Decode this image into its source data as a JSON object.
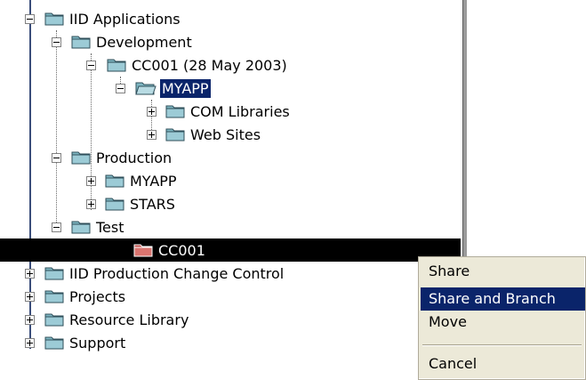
{
  "tree": {
    "nodes": [
      {
        "label": "IID Applications",
        "expander": "expanded",
        "icon": "folder-icon"
      },
      {
        "label": "Development",
        "expander": "expanded",
        "icon": "folder-icon"
      },
      {
        "label": "CC001 (28 May 2003)",
        "expander": "expanded",
        "icon": "folder-icon"
      },
      {
        "label": "MYAPP",
        "expander": "expanded",
        "icon": "open-folder-icon",
        "highlighted": true
      },
      {
        "label": "COM Libraries",
        "expander": "collapsed",
        "icon": "folder-icon"
      },
      {
        "label": "Web Sites",
        "expander": "collapsed",
        "icon": "folder-icon"
      },
      {
        "label": "Production",
        "expander": "expanded",
        "icon": "folder-icon"
      },
      {
        "label": "MYAPP",
        "expander": "collapsed",
        "icon": "folder-icon"
      },
      {
        "label": "STARS",
        "expander": "collapsed",
        "icon": "folder-icon"
      },
      {
        "label": "Test",
        "expander": "expanded",
        "icon": "folder-icon"
      },
      {
        "label": "CC001",
        "expander": "none",
        "icon": "red-folder-icon",
        "selected_row": true
      },
      {
        "label": "IID Production Change Control",
        "expander": "collapsed",
        "icon": "folder-icon"
      },
      {
        "label": "Projects",
        "expander": "collapsed",
        "icon": "folder-icon"
      },
      {
        "label": "Resource Library",
        "expander": "collapsed",
        "icon": "folder-icon"
      },
      {
        "label": "Support",
        "expander": "collapsed",
        "icon": "folder-icon"
      }
    ]
  },
  "context_menu": {
    "share": "Share",
    "share_and_branch": "Share and Branch",
    "move": "Move",
    "cancel": "Cancel",
    "active_item": "Share and Branch"
  },
  "colors": {
    "selection": "#0a246a",
    "menu_background": "#ece9d8",
    "folder_teal": "#7fb7c3",
    "folder_red": "#c0504d"
  }
}
